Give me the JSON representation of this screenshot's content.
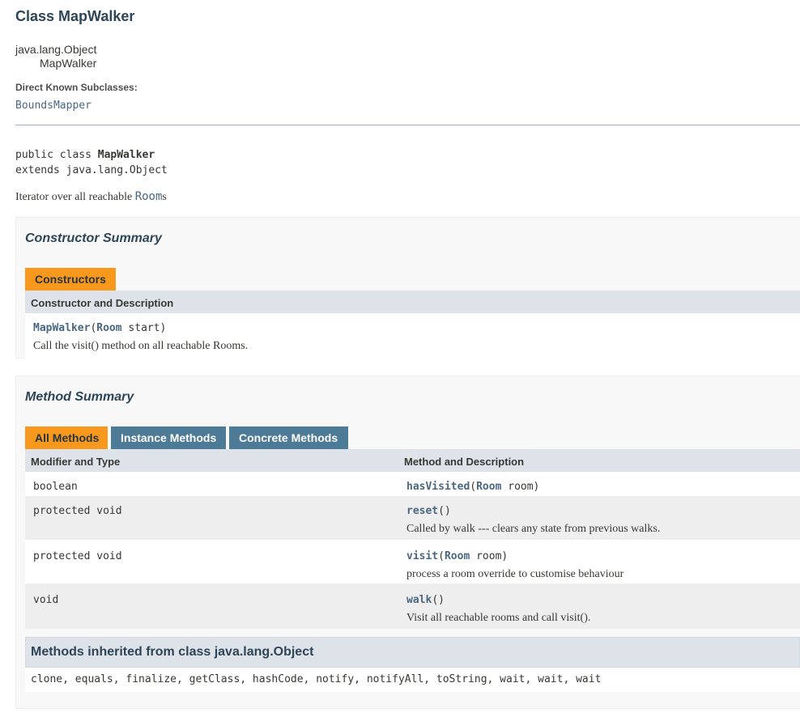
{
  "header": {
    "title": "Class MapWalker",
    "inheritance": [
      "java.lang.Object",
      "MapWalker"
    ],
    "subclasses_label": "Direct Known Subclasses:",
    "subclasses": [
      "BoundsMapper"
    ]
  },
  "declaration": {
    "prefix": "public class ",
    "class_name": "MapWalker",
    "extends_line": "extends java.lang.Object",
    "description_text": "Iterator over all reachable ",
    "description_link": "Room",
    "description_suffix": "s"
  },
  "constructor_summary": {
    "title": "Constructor Summary",
    "tab": "Constructors",
    "column": "Constructor and Description",
    "rows": [
      {
        "name": "MapWalker",
        "open": "(",
        "param_type": "Room",
        "param_rest": " start)",
        "description": "Call the visit() method on all reachable Rooms."
      }
    ]
  },
  "method_summary": {
    "title": "Method Summary",
    "tabs": [
      "All Methods",
      "Instance Methods",
      "Concrete Methods"
    ],
    "columns": [
      "Modifier and Type",
      "Method and Description"
    ],
    "rows": [
      {
        "modifier": "boolean",
        "name": "hasVisited",
        "open": "(",
        "param_type": "Room",
        "param_rest": " room)",
        "description": ""
      },
      {
        "modifier": "protected void",
        "name": "reset",
        "open": "()",
        "param_type": "",
        "param_rest": "",
        "description": "Called by walk --- clears any state from previous walks."
      },
      {
        "modifier": "protected void",
        "name": "visit",
        "open": "(",
        "param_type": "Room",
        "param_rest": " room)",
        "description": "process a room override to customise behaviour"
      },
      {
        "modifier": "void",
        "name": "walk",
        "open": "()",
        "param_type": "",
        "param_rest": "",
        "description": "Visit all reachable rooms and call visit()."
      }
    ]
  },
  "inherited": {
    "title": "Methods inherited from class java.lang.Object",
    "methods": "clone, equals, finalize, getClass, hashCode, notify, notifyAll, toString, wait, wait, wait"
  }
}
